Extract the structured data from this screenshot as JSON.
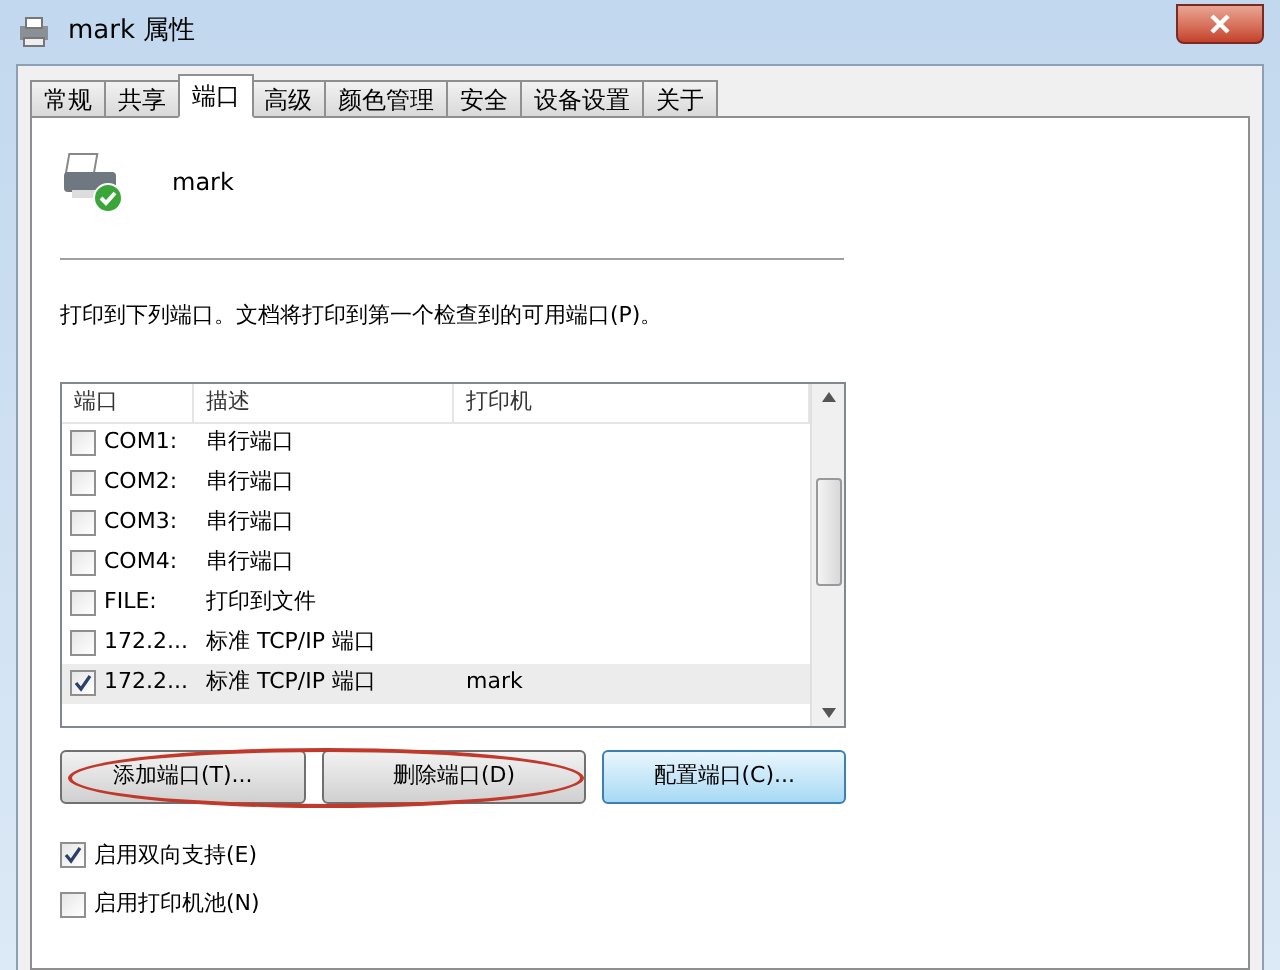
{
  "window": {
    "title": "mark 属性"
  },
  "tabs": [
    {
      "label": "常规",
      "selected": false
    },
    {
      "label": "共享",
      "selected": false
    },
    {
      "label": "端口",
      "selected": true
    },
    {
      "label": "高级",
      "selected": false
    },
    {
      "label": "颜色管理",
      "selected": false
    },
    {
      "label": "安全",
      "selected": false
    },
    {
      "label": "设备设置",
      "selected": false
    },
    {
      "label": "关于",
      "selected": false
    }
  ],
  "printer_name": "mark",
  "instruction": "打印到下列端口。文档将打印到第一个检查到的可用端口(P)。",
  "table": {
    "columns": [
      "端口",
      "描述",
      "打印机"
    ],
    "rows": [
      {
        "port": "COM1:",
        "description": "串行端口",
        "printer": "",
        "checked": false,
        "selected": false
      },
      {
        "port": "COM2:",
        "description": "串行端口",
        "printer": "",
        "checked": false,
        "selected": false
      },
      {
        "port": "COM3:",
        "description": "串行端口",
        "printer": "",
        "checked": false,
        "selected": false
      },
      {
        "port": "COM4:",
        "description": "串行端口",
        "printer": "",
        "checked": false,
        "selected": false
      },
      {
        "port": "FILE:",
        "description": "打印到文件",
        "printer": "",
        "checked": false,
        "selected": false
      },
      {
        "port": "172.2...",
        "description": "标准 TCP/IP 端口",
        "printer": "",
        "checked": false,
        "selected": false
      },
      {
        "port": "172.2...",
        "description": "标准 TCP/IP 端口",
        "printer": "mark",
        "checked": true,
        "selected": true
      }
    ]
  },
  "buttons": [
    {
      "label": "添加端口(T)...",
      "focused": false
    },
    {
      "label": "删除端口(D)",
      "focused": false
    },
    {
      "label": "配置端口(C)...",
      "focused": true
    }
  ],
  "options": [
    {
      "label": "启用双向支持(E)",
      "checked": true
    },
    {
      "label": "启用打印机池(N)",
      "checked": false
    }
  ]
}
